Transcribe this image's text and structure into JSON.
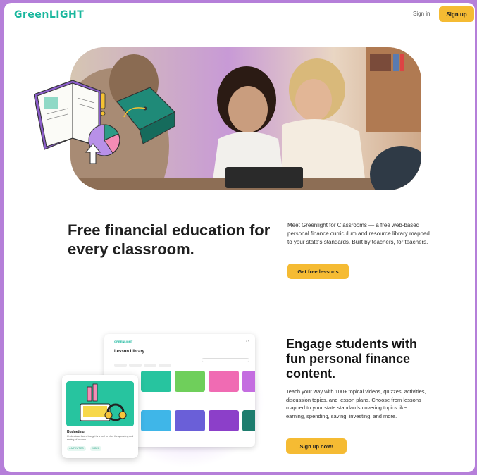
{
  "header": {
    "logo": "GreenLIGHT",
    "signin_label": "Sign in",
    "signup_label": "Sign up"
  },
  "hero": {
    "image": "photo-of-teacher-and-student",
    "illustration": "book-graduation-cap-chart-illustration"
  },
  "section1": {
    "headline": "Free financial education for every classroom.",
    "body": "Meet Greenlight for Classrooms — a free web-based personal finance curriculum and resource library mapped to your state's standards. Built by teachers, for teachers.",
    "cta": "Get free lessons"
  },
  "section2": {
    "headline": "Engage students with fun personal finance content.",
    "body": "Teach your way with 100+ topical videos, quizzes, activities, discussion topics, and lesson plans. Choose from lessons mapped to your state standards covering topics like earning, spending, saving, investing, and more.",
    "cta": "Sign up now!",
    "mockup": {
      "app_title": "Lesson Library",
      "card_title": "Budgeting",
      "card_desc": "Understand that a budget is a tool to plan the spending and saving of income",
      "card_tags": [
        "4 ACTIVITIES",
        "VIDEO"
      ]
    }
  },
  "colors": {
    "brand_green": "#19b79d",
    "accent_yellow": "#f5bb33",
    "frame_purple": "#b57fd9"
  }
}
